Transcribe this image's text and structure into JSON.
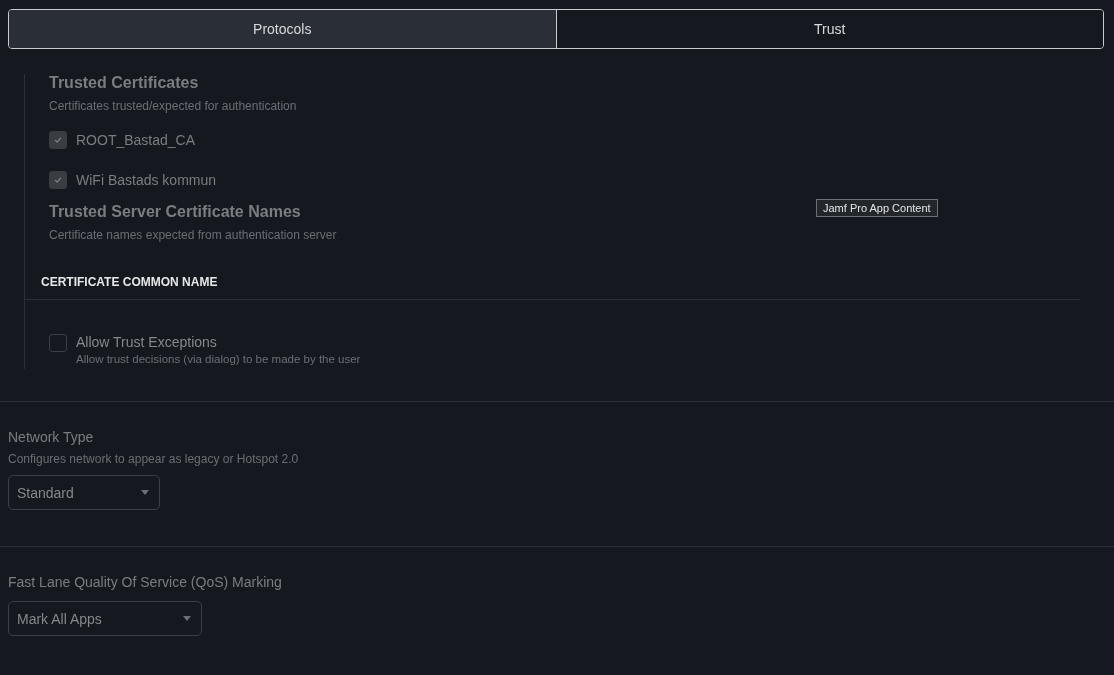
{
  "tabs": [
    {
      "label": "Protocols",
      "selected": true
    },
    {
      "label": "Trust",
      "selected": false
    }
  ],
  "trusted_certificates": {
    "title": "Trusted Certificates",
    "description": "Certificates trusted/expected for authentication",
    "items": [
      {
        "label": "ROOT_Bastad_CA",
        "checked": true
      },
      {
        "label": "WiFi Bastads kommun",
        "checked": true
      }
    ]
  },
  "trusted_server_names": {
    "title": "Trusted Server Certificate Names",
    "description": "Certificate names expected from authentication server",
    "columns": [
      "CERTIFICATE COMMON NAME"
    ]
  },
  "allow_trust_exceptions": {
    "label": "Allow Trust Exceptions",
    "description": "Allow trust decisions (via dialog) to be made by the user",
    "checked": false
  },
  "tooltip": "Jamf Pro App Content",
  "network_type": {
    "label": "Network Type",
    "description": "Configures network to appear as legacy or Hotspot 2.0",
    "value": "Standard"
  },
  "fast_lane": {
    "label": "Fast Lane Quality Of Service (QoS) Marking",
    "value": "Mark All Apps"
  }
}
